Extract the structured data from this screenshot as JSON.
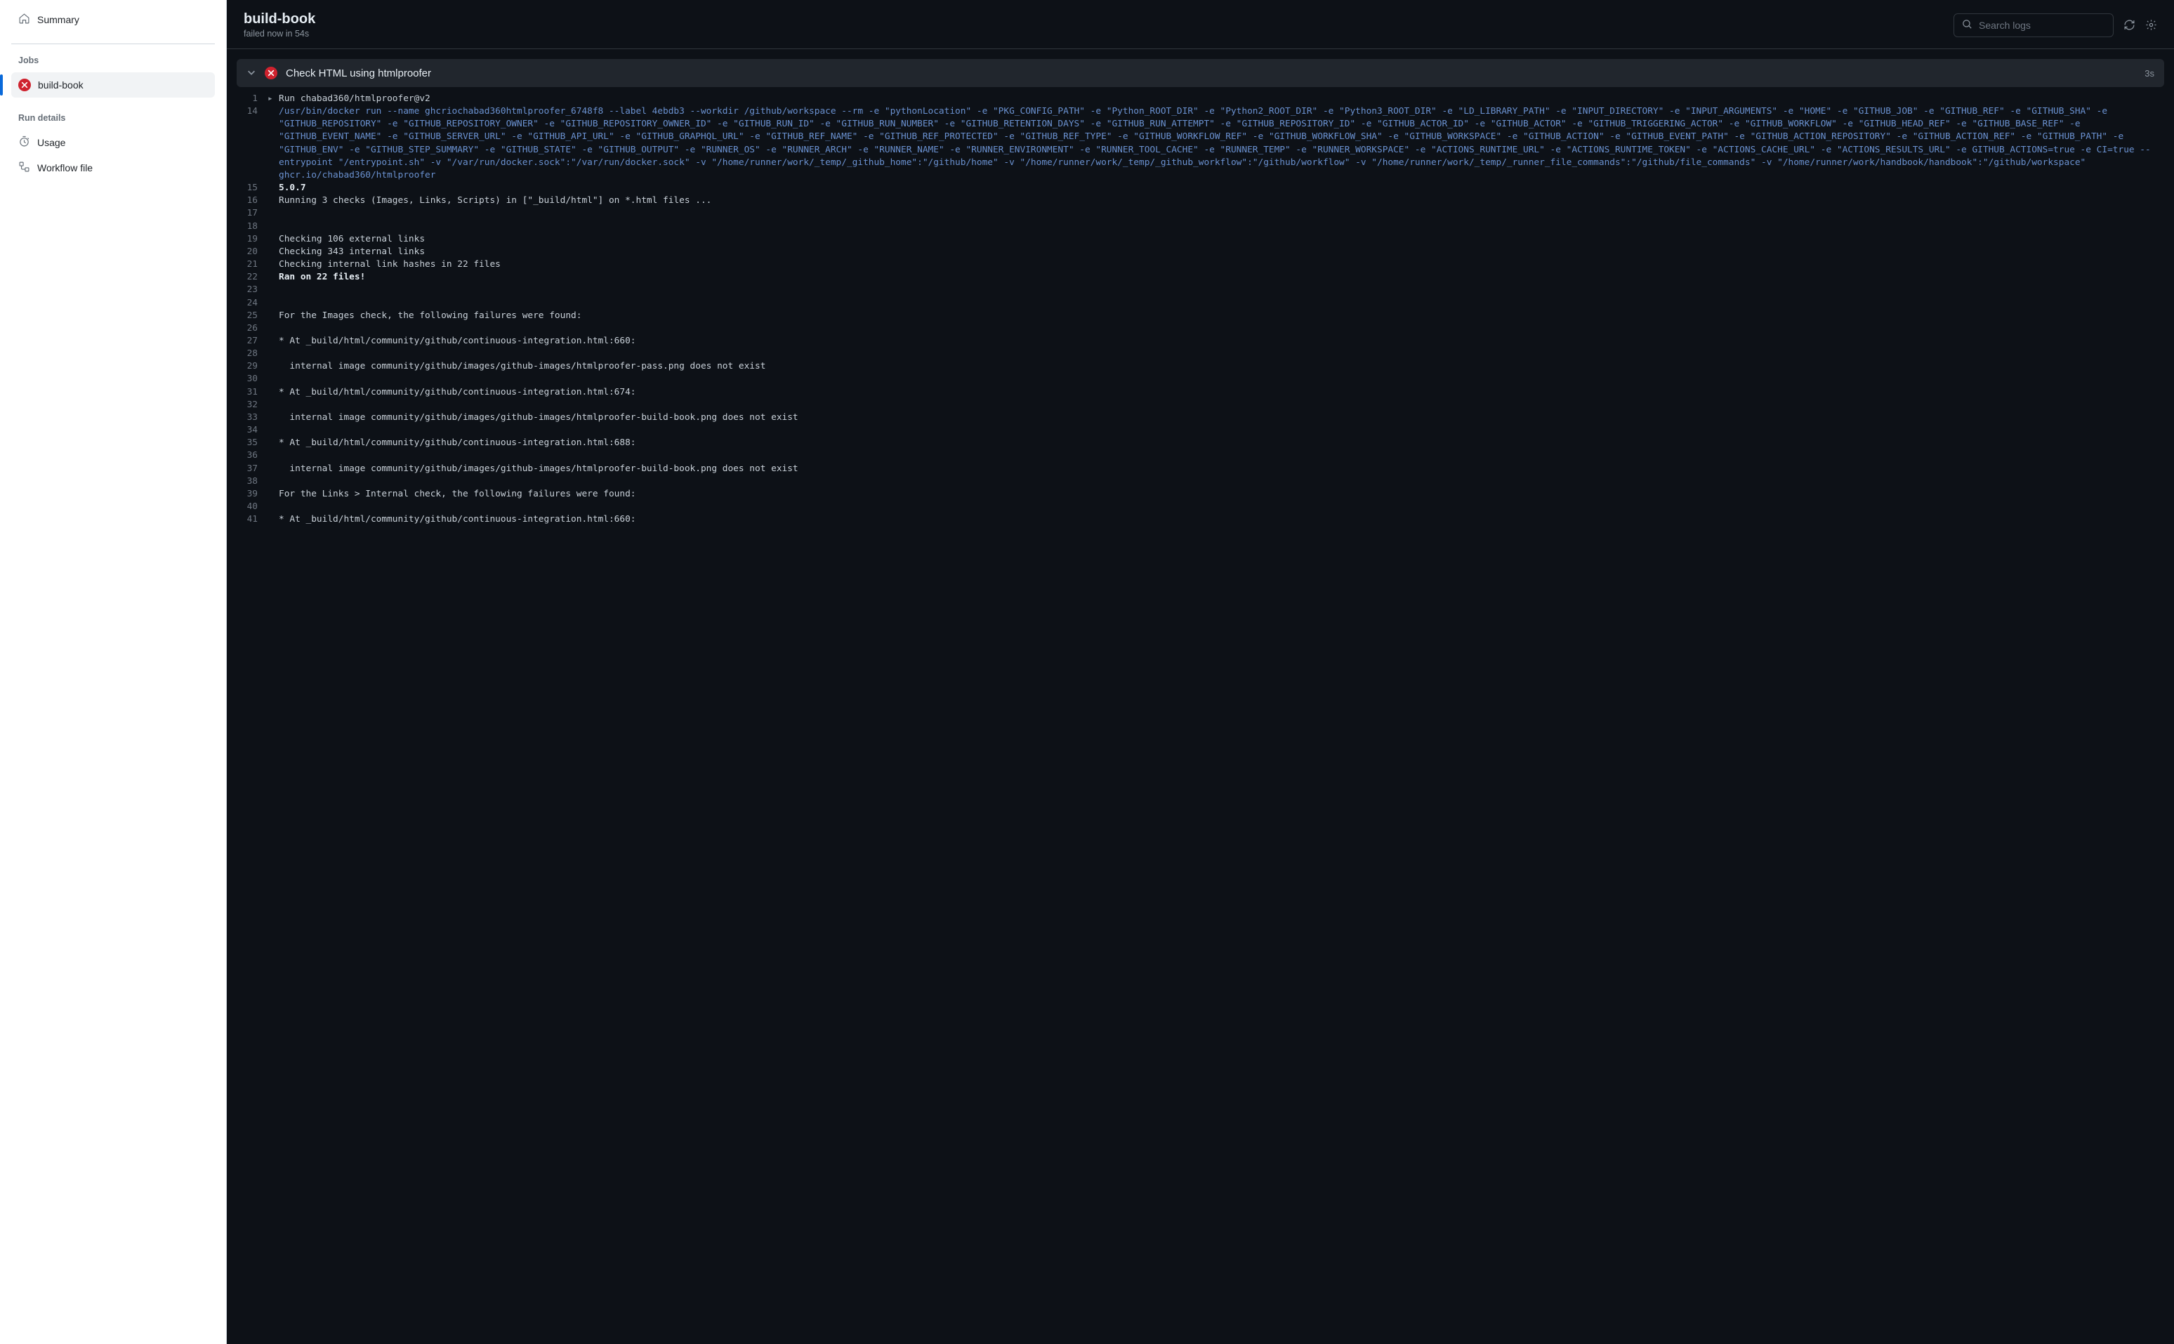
{
  "sidebar": {
    "summary_label": "Summary",
    "jobs_label": "Jobs",
    "job_name": "build-book",
    "run_details_label": "Run details",
    "usage_label": "Usage",
    "workflow_label": "Workflow file"
  },
  "header": {
    "title": "build-book",
    "subtitle": "failed now in 54s",
    "search_placeholder": "Search logs"
  },
  "step": {
    "name": "Check HTML using htmlproofer",
    "duration": "3s"
  },
  "log": {
    "run_line": "Run chabad360/htmlproofer@v2",
    "docker_cmd": "/usr/bin/docker run --name ghcriochabad360htmlproofer_6748f8 --label 4ebdb3 --workdir /github/workspace --rm -e \"pythonLocation\" -e \"PKG_CONFIG_PATH\" -e \"Python_ROOT_DIR\" -e \"Python2_ROOT_DIR\" -e \"Python3_ROOT_DIR\" -e \"LD_LIBRARY_PATH\" -e \"INPUT_DIRECTORY\" -e \"INPUT_ARGUMENTS\" -e \"HOME\" -e \"GITHUB_JOB\" -e \"GITHUB_REF\" -e \"GITHUB_SHA\" -e \"GITHUB_REPOSITORY\" -e \"GITHUB_REPOSITORY_OWNER\" -e \"GITHUB_REPOSITORY_OWNER_ID\" -e \"GITHUB_RUN_ID\" -e \"GITHUB_RUN_NUMBER\" -e \"GITHUB_RETENTION_DAYS\" -e \"GITHUB_RUN_ATTEMPT\" -e \"GITHUB_REPOSITORY_ID\" -e \"GITHUB_ACTOR_ID\" -e \"GITHUB_ACTOR\" -e \"GITHUB_TRIGGERING_ACTOR\" -e \"GITHUB_WORKFLOW\" -e \"GITHUB_HEAD_REF\" -e \"GITHUB_BASE_REF\" -e \"GITHUB_EVENT_NAME\" -e \"GITHUB_SERVER_URL\" -e \"GITHUB_API_URL\" -e \"GITHUB_GRAPHQL_URL\" -e \"GITHUB_REF_NAME\" -e \"GITHUB_REF_PROTECTED\" -e \"GITHUB_REF_TYPE\" -e \"GITHUB_WORKFLOW_REF\" -e \"GITHUB_WORKFLOW_SHA\" -e \"GITHUB_WORKSPACE\" -e \"GITHUB_ACTION\" -e \"GITHUB_EVENT_PATH\" -e \"GITHUB_ACTION_REPOSITORY\" -e \"GITHUB_ACTION_REF\" -e \"GITHUB_PATH\" -e \"GITHUB_ENV\" -e \"GITHUB_STEP_SUMMARY\" -e \"GITHUB_STATE\" -e \"GITHUB_OUTPUT\" -e \"RUNNER_OS\" -e \"RUNNER_ARCH\" -e \"RUNNER_NAME\" -e \"RUNNER_ENVIRONMENT\" -e \"RUNNER_TOOL_CACHE\" -e \"RUNNER_TEMP\" -e \"RUNNER_WORKSPACE\" -e \"ACTIONS_RUNTIME_URL\" -e \"ACTIONS_RUNTIME_TOKEN\" -e \"ACTIONS_CACHE_URL\" -e \"ACTIONS_RESULTS_URL\" -e GITHUB_ACTIONS=true -e CI=true --entrypoint \"/entrypoint.sh\" -v \"/var/run/docker.sock\":\"/var/run/docker.sock\" -v \"/home/runner/work/_temp/_github_home\":\"/github/home\" -v \"/home/runner/work/_temp/_github_workflow\":\"/github/workflow\" -v \"/home/runner/work/_temp/_runner_file_commands\":\"/github/file_commands\" -v \"/home/runner/work/handbook/handbook\":\"/github/workspace\" ghcr.io/chabad360/htmlproofer",
    "lines": [
      {
        "n": 15,
        "cls": "bold",
        "t": "5.0.7"
      },
      {
        "n": 16,
        "cls": "norm",
        "t": "Running 3 checks (Images, Links, Scripts) in [\"_build/html\"] on *.html files ..."
      },
      {
        "n": 17,
        "cls": "norm",
        "t": ""
      },
      {
        "n": 18,
        "cls": "norm",
        "t": ""
      },
      {
        "n": 19,
        "cls": "norm",
        "t": "Checking 106 external links"
      },
      {
        "n": 20,
        "cls": "norm",
        "t": "Checking 343 internal links"
      },
      {
        "n": 21,
        "cls": "norm",
        "t": "Checking internal link hashes in 22 files"
      },
      {
        "n": 22,
        "cls": "bold",
        "t": "Ran on 22 files!"
      },
      {
        "n": 23,
        "cls": "norm",
        "t": ""
      },
      {
        "n": 24,
        "cls": "norm",
        "t": ""
      },
      {
        "n": 25,
        "cls": "norm",
        "t": "For the Images check, the following failures were found:"
      },
      {
        "n": 26,
        "cls": "norm",
        "t": ""
      },
      {
        "n": 27,
        "cls": "norm",
        "t": "* At _build/html/community/github/continuous-integration.html:660:"
      },
      {
        "n": 28,
        "cls": "norm",
        "t": ""
      },
      {
        "n": 29,
        "cls": "norm",
        "t": "  internal image community/github/images/github-images/htmlproofer-pass.png does not exist"
      },
      {
        "n": 30,
        "cls": "norm",
        "t": ""
      },
      {
        "n": 31,
        "cls": "norm",
        "t": "* At _build/html/community/github/continuous-integration.html:674:"
      },
      {
        "n": 32,
        "cls": "norm",
        "t": ""
      },
      {
        "n": 33,
        "cls": "norm",
        "t": "  internal image community/github/images/github-images/htmlproofer-build-book.png does not exist"
      },
      {
        "n": 34,
        "cls": "norm",
        "t": ""
      },
      {
        "n": 35,
        "cls": "norm",
        "t": "* At _build/html/community/github/continuous-integration.html:688:"
      },
      {
        "n": 36,
        "cls": "norm",
        "t": ""
      },
      {
        "n": 37,
        "cls": "norm",
        "t": "  internal image community/github/images/github-images/htmlproofer-build-book.png does not exist"
      },
      {
        "n": 38,
        "cls": "norm",
        "t": ""
      },
      {
        "n": 39,
        "cls": "norm",
        "t": "For the Links > Internal check, the following failures were found:"
      },
      {
        "n": 40,
        "cls": "norm",
        "t": ""
      },
      {
        "n": 41,
        "cls": "norm",
        "t": "* At _build/html/community/github/continuous-integration.html:660:"
      }
    ]
  }
}
